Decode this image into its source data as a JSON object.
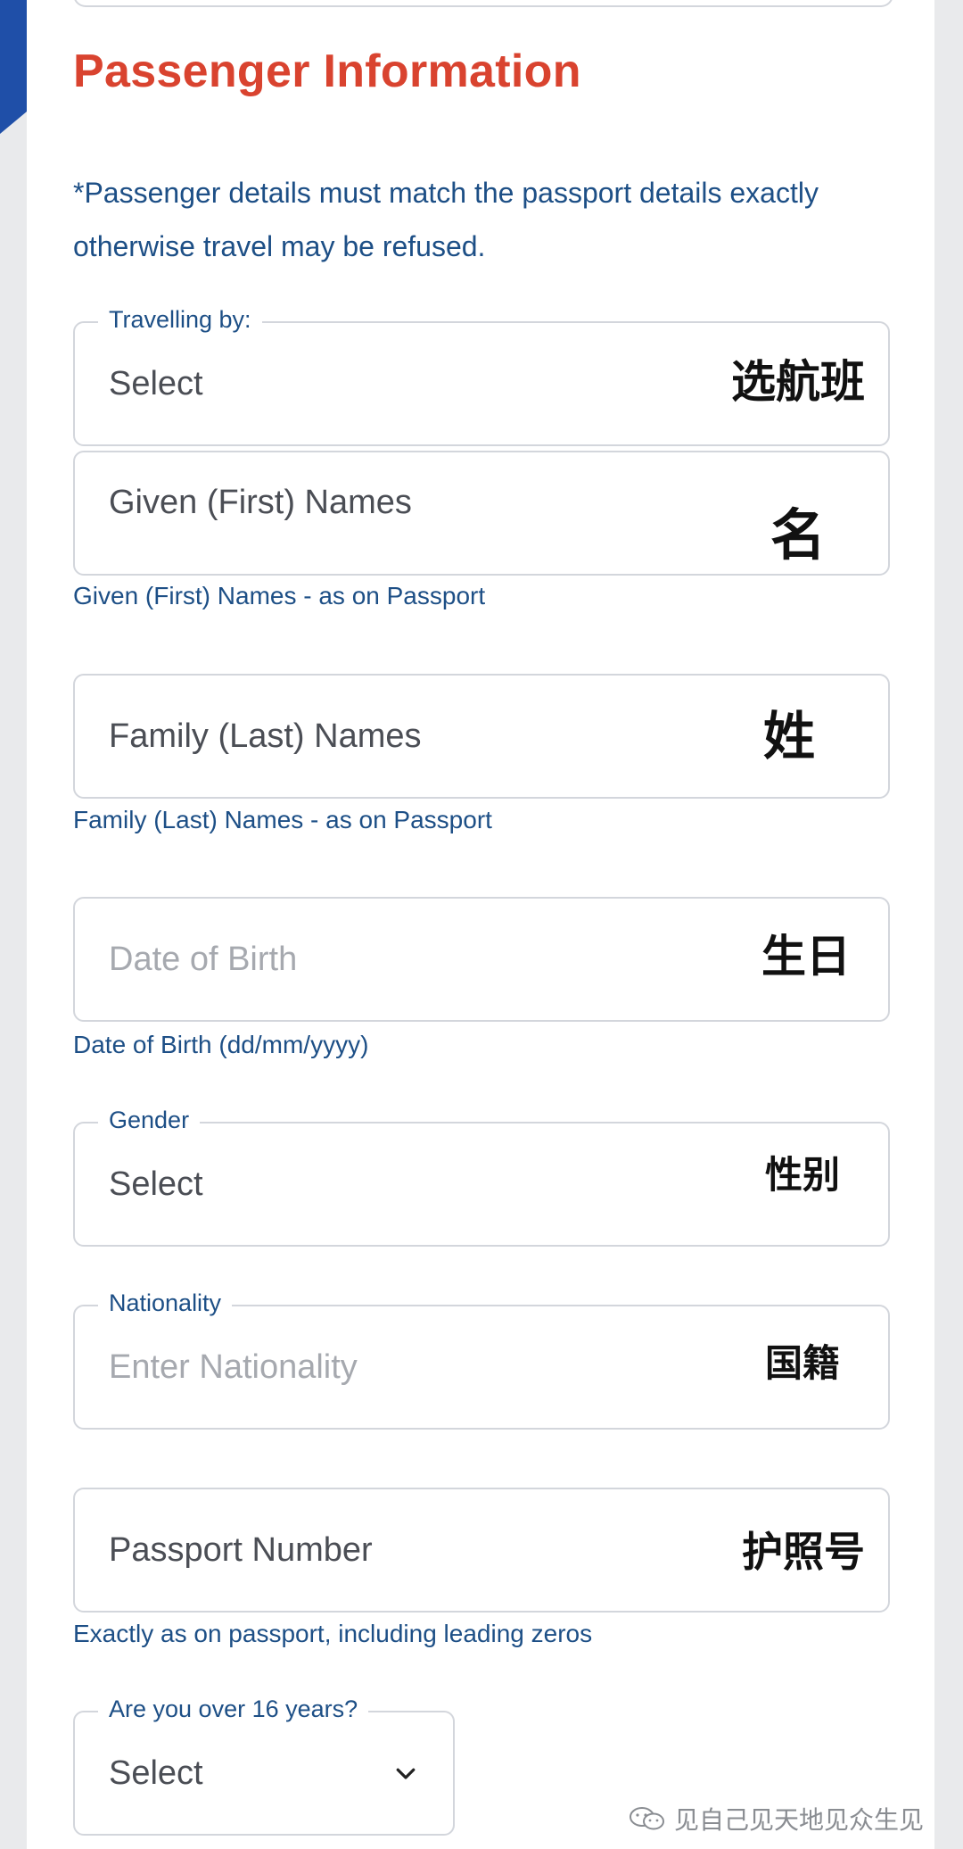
{
  "section_title": "Passenger Information",
  "notice": "*Passenger details must match the passport details exactly otherwise travel may be refused.",
  "fields": {
    "travelling_by": {
      "label": "Travelling by:",
      "value": "Select",
      "note": "选航班"
    },
    "given_names": {
      "value": "Given (First) Names",
      "note": "名",
      "hint": "Given (First) Names - as on Passport"
    },
    "family_names": {
      "value": "Family (Last) Names",
      "note": "姓",
      "hint": "Family (Last) Names - as on Passport"
    },
    "date_of_birth": {
      "placeholder": "Date of Birth",
      "note": "生日",
      "hint": "Date of Birth (dd/mm/yyyy)"
    },
    "gender": {
      "label": "Gender",
      "value": "Select",
      "note": "性别"
    },
    "nationality": {
      "label": "Nationality",
      "placeholder": "Enter Nationality",
      "note": "国籍"
    },
    "passport_number": {
      "value": "Passport Number",
      "note": "护照号",
      "hint": "Exactly as on passport, including leading zeros"
    },
    "over_16": {
      "label": "Are you over 16 years?",
      "value": "Select"
    }
  },
  "watermark": "见自己见天地见众生见",
  "icons": {
    "dropdown": "chevron-down-icon",
    "watermark": "wechat-icon"
  },
  "colors": {
    "title": "#d9432f",
    "text_blue": "#1d4f86",
    "border": "#d3d6dc",
    "accent_stripe": "#1f4fa8"
  }
}
